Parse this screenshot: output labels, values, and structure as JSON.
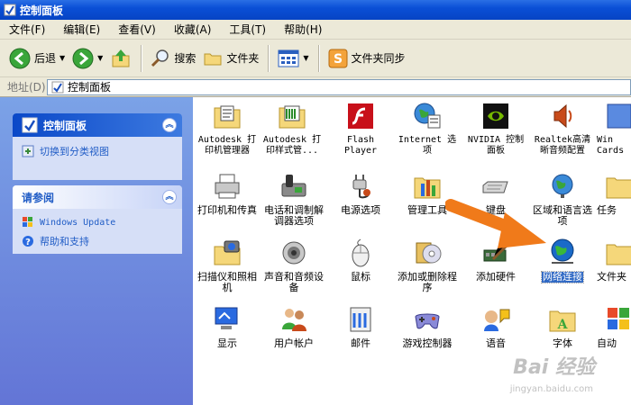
{
  "window": {
    "title": "控制面板"
  },
  "menu": [
    "文件(F)",
    "编辑(E)",
    "查看(V)",
    "收藏(A)",
    "工具(T)",
    "帮助(H)"
  ],
  "toolbar": {
    "back": "后退",
    "search": "搜索",
    "folders": "文件夹",
    "sync": "文件夹同步"
  },
  "address": {
    "label": "地址(D)",
    "value": "控制面板"
  },
  "left": {
    "panel1": {
      "title": "控制面板",
      "link": "切换到分类视图"
    },
    "panel2": {
      "title": "请参阅",
      "links": [
        "Windows Update",
        "帮助和支持"
      ]
    }
  },
  "items": [
    "Autodesk 打印机管理器",
    "Autodesk 打印样式管...",
    "Flash Player",
    "Internet 选项",
    "NVIDIA 控制面板",
    "Realtek高清晰音频配置",
    "Win Cards",
    "打印机和传真",
    "电话和调制解调器选项",
    "电源选项",
    "管理工具",
    "键盘",
    "区域和语言选项",
    "任务",
    "扫描仪和照相机",
    "声音和音频设备",
    "鼠标",
    "添加或删除程序",
    "添加硬件",
    "网络连接",
    "文件夹",
    "显示",
    "用户帐户",
    "邮件",
    "游戏控制器",
    "语音",
    "字体",
    "自动"
  ],
  "watermark": {
    "brand": "Bai 经验",
    "url": "jingyan.baidu.com"
  },
  "colors": {
    "titlebar": "#0a4fd6",
    "sidebar": "#6f8fdf",
    "selection": "#316ac5",
    "arrow": "#f07a1a"
  }
}
